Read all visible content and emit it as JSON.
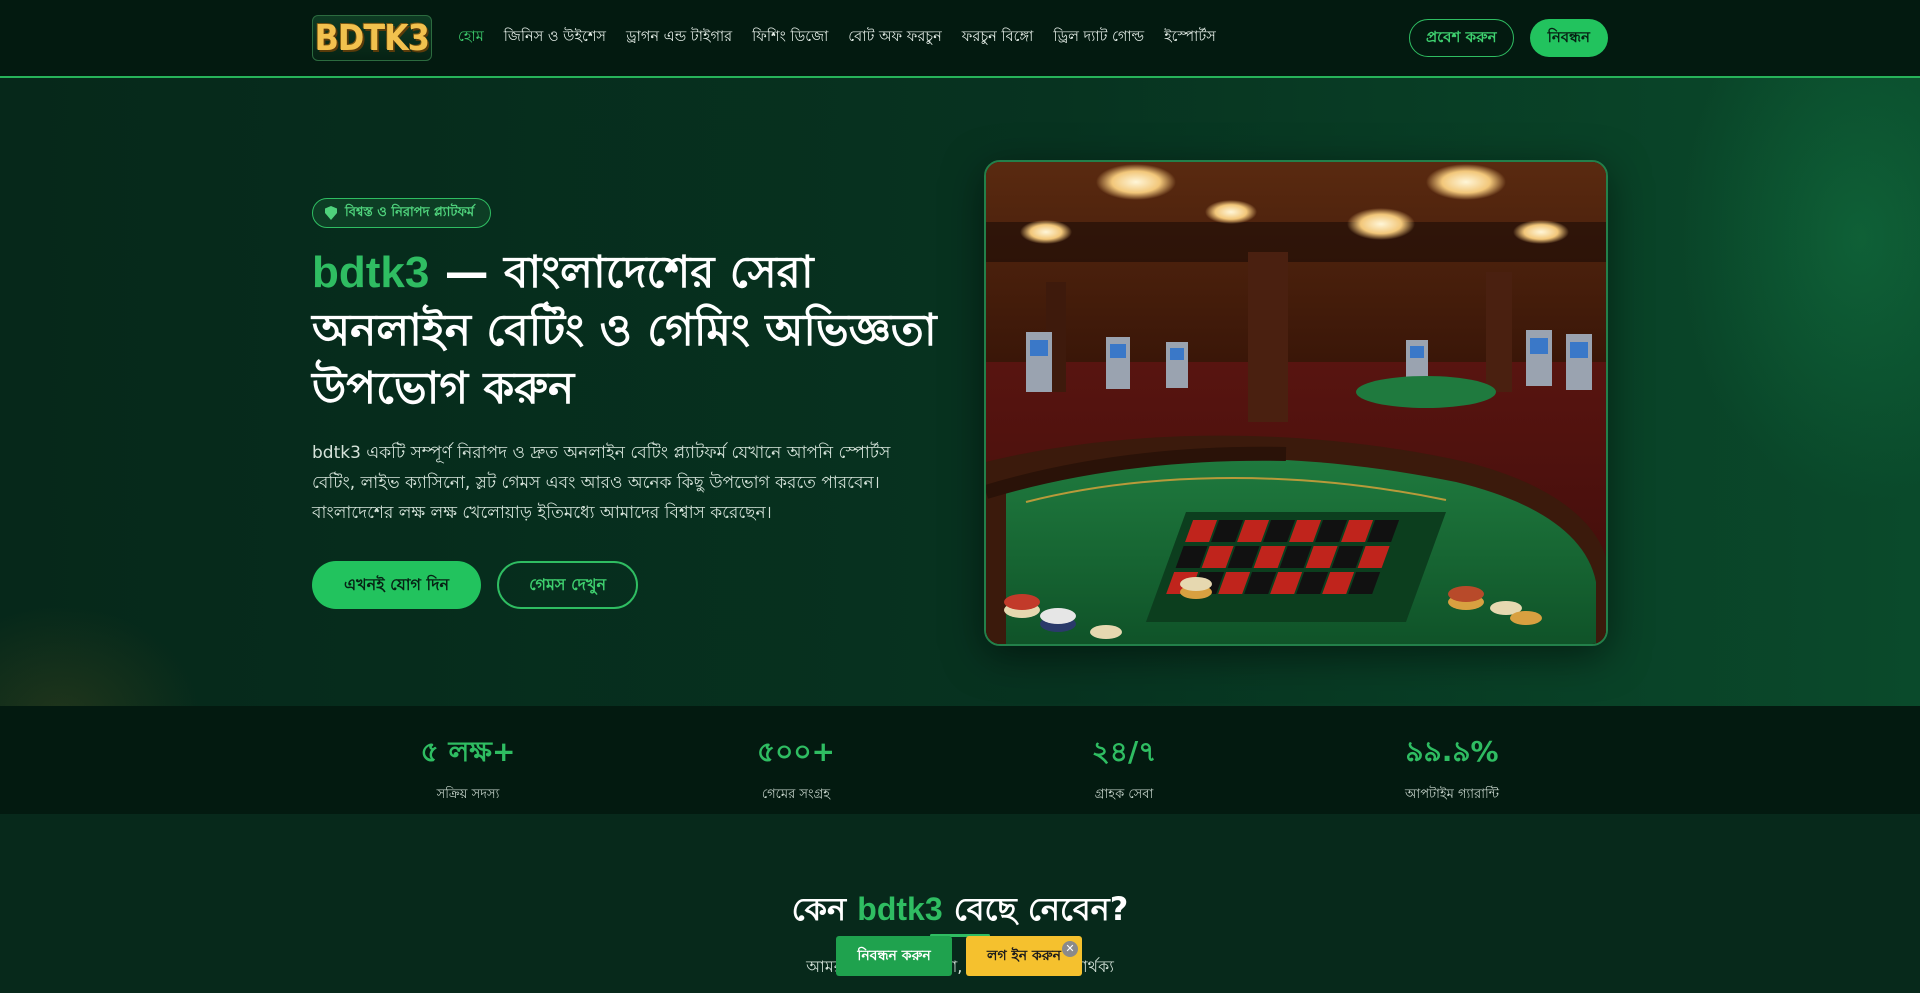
{
  "header": {
    "logo_text": "BDTK3",
    "nav": [
      {
        "label": "হোম",
        "active": true
      },
      {
        "label": "জিনিস ও উইশেস"
      },
      {
        "label": "ড্রাগন এন্ড টাইগার"
      },
      {
        "label": "ফিশিং ডিজো"
      },
      {
        "label": "বোট অফ ফরচুন"
      },
      {
        "label": "ফরচুন বিঙ্গো"
      },
      {
        "label": "ড্রিল দ্যাট গোল্ড"
      },
      {
        "label": "ইস্পোর্টস"
      }
    ],
    "login_label": "প্রবেশ করুন",
    "register_label": "নিবন্ধন"
  },
  "hero": {
    "badge": "বিশ্বস্ত ও নিরাপদ প্ল্যাটফর্ম",
    "title_brand": "bdtk3",
    "title_rest": " — বাংলাদেশের সেরা অনলাইন বেটিং ও গেমিং অভিজ্ঞতা উপভোগ করুন",
    "description": "bdtk3 একটি সম্পূর্ণ নিরাপদ ও দ্রুত অনলাইন বেটিং প্ল্যাটফর্ম যেখানে আপনি স্পোর্টস বেটিং, লাইভ ক্যাসিনো, স্লট গেমস এবং আরও অনেক কিছু উপভোগ করতে পারবেন। বাংলাদেশের লক্ষ লক্ষ খেলোয়াড় ইতিমধ্যে আমাদের বিশ্বাস করেছেন।",
    "primary_button": "এখনই যোগ দিন",
    "secondary_button": "গেমস দেখুন"
  },
  "stats": [
    {
      "value": "৫ লক্ষ+",
      "label": "সক্রিয় সদস্য"
    },
    {
      "value": "৫০০+",
      "label": "গেমের সংগ্রহ"
    },
    {
      "value": "২৪/৭",
      "label": "গ্রাহক সেবা"
    },
    {
      "value": "৯৯.৯%",
      "label": "আপটাইম গ্যারান্টি"
    }
  ],
  "why": {
    "title_prefix": "কেন ",
    "title_brand": "bdtk3",
    "title_suffix": " বেছে নেবেন?",
    "subtitle": "আমরা যা দিই পাবেন না, সেটাই আমাদের পার্থক্য"
  },
  "floating": {
    "register_label": "নিবন্ধন করুন",
    "login_label": "লগ ইন করুন",
    "close_symbol": "✕"
  }
}
